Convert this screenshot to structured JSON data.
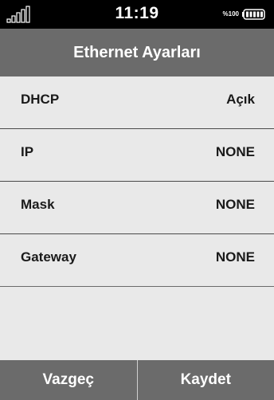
{
  "status_bar": {
    "time": "11:19",
    "battery_percent": "%100",
    "signal_icon": "signal-bars-icon",
    "battery_icon": "battery-full-icon"
  },
  "header": {
    "title": "Ethernet Ayarları"
  },
  "settings": [
    {
      "label": "DHCP",
      "value": "Açık"
    },
    {
      "label": "IP",
      "value": "NONE"
    },
    {
      "label": "Mask",
      "value": "NONE"
    },
    {
      "label": "Gateway",
      "value": "NONE"
    }
  ],
  "footer": {
    "cancel_label": "Vazgeç",
    "save_label": "Kaydet"
  },
  "colors": {
    "status_bar_bg": "#000000",
    "header_bg": "#6b6b6b",
    "list_bg": "#e9e9e9",
    "footer_bg": "#6b6b6b",
    "text_light": "#ffffff",
    "text_dark": "#1a1a1a"
  }
}
